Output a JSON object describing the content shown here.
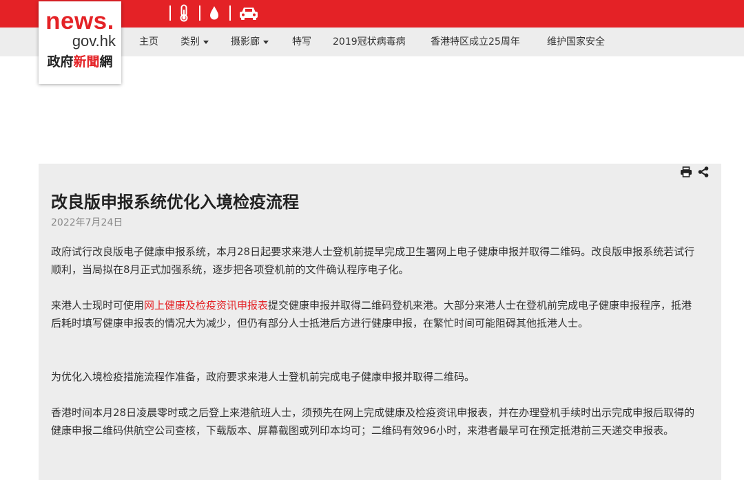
{
  "site": {
    "logo_line1": "news.",
    "logo_line2": "gov.hk",
    "logo_line3_part1": "政府",
    "logo_line3_part2": "新聞",
    "logo_line3_part3": "網"
  },
  "topbar": {
    "icons": [
      "thermometer-icon",
      "raindrop-icon",
      "car-icon"
    ],
    "background": "#e42226"
  },
  "nav": {
    "items": [
      {
        "label": "主页",
        "dropdown": false
      },
      {
        "label": "类别",
        "dropdown": true
      },
      {
        "label": "摄影廊",
        "dropdown": true
      },
      {
        "label": "特写",
        "dropdown": false
      },
      {
        "label": "2019冠状病毒病",
        "dropdown": false
      },
      {
        "label": "香港特区成立25周年",
        "dropdown": false
      },
      {
        "label": "维护国家安全",
        "dropdown": false
      }
    ]
  },
  "article": {
    "title": "改良版申报系统优化入境检疫流程",
    "date": "2022年7月24日",
    "p1": "政府试行改良版电子健康申报系统，本月28日起要求来港人士登机前提早完成卫生署网上电子健康申报并取得二维码。改良版申报系统若试行顺利，当局拟在8月正式加强系统，逐步把各项登机前的文件确认程序电子化。",
    "p2_before": "来港人士现时可使用",
    "p2_link": "网上健康及检疫资讯申报表",
    "p2_after": "提交健康申报并取得二维码登机来港。大部分来港人士在登机前完成电子健康申报程序，抵港后耗时填写健康申报表的情况大为减少，但仍有部分人士抵港后方进行健康申报，在繁忙时间可能阻碍其他抵港人士。",
    "p3": "为优化入境检疫措施流程作准备，政府要求来港人士登机前完成电子健康申报并取得二维码。",
    "p4": "香港时间本月28日凌晨零时或之后登上来港航班人士，须预先在网上完成健康及检疫资讯申报表，并在办理登机手续时出示完成申报后取得的健康申报二维码供航空公司查核，下载版本、屏幕截图或列印本均可；二维码有效96小时，来港者最早可在预定抵港前三天递交申报表。",
    "tools": [
      "print-icon",
      "share-icon"
    ]
  }
}
